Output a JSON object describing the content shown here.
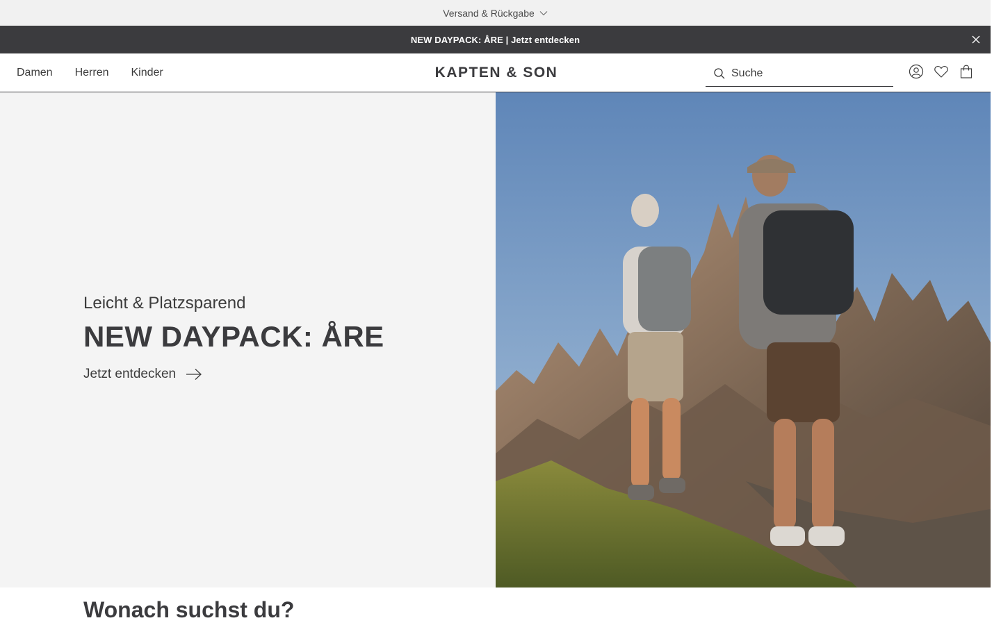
{
  "topbar": {
    "shipping_label": "Versand & Rückgabe"
  },
  "promo": {
    "text": "NEW DAYPACK: ÅRE | Jetzt entdecken"
  },
  "header": {
    "nav": [
      {
        "label": "Damen"
      },
      {
        "label": "Herren"
      },
      {
        "label": "Kinder"
      }
    ],
    "logo": "KAPTEN & SON",
    "search": {
      "placeholder": "Suche",
      "value": ""
    },
    "icons": [
      "account-icon",
      "wishlist-heart-icon",
      "shopping-bag-icon"
    ]
  },
  "hero": {
    "subtitle": "Leicht & Platzsparend",
    "title": "NEW DAYPACK: ÅRE",
    "cta_label": "Jetzt entdecken",
    "image_alt_icon": "hikers-mountain-photo"
  },
  "section": {
    "title": "Wonach suchst du?"
  },
  "colors": {
    "dark": "#3b3b3e",
    "topbar_bg": "#f1f1f1",
    "hero_left_bg": "#f4f4f4",
    "sky": "#6b91c0"
  }
}
